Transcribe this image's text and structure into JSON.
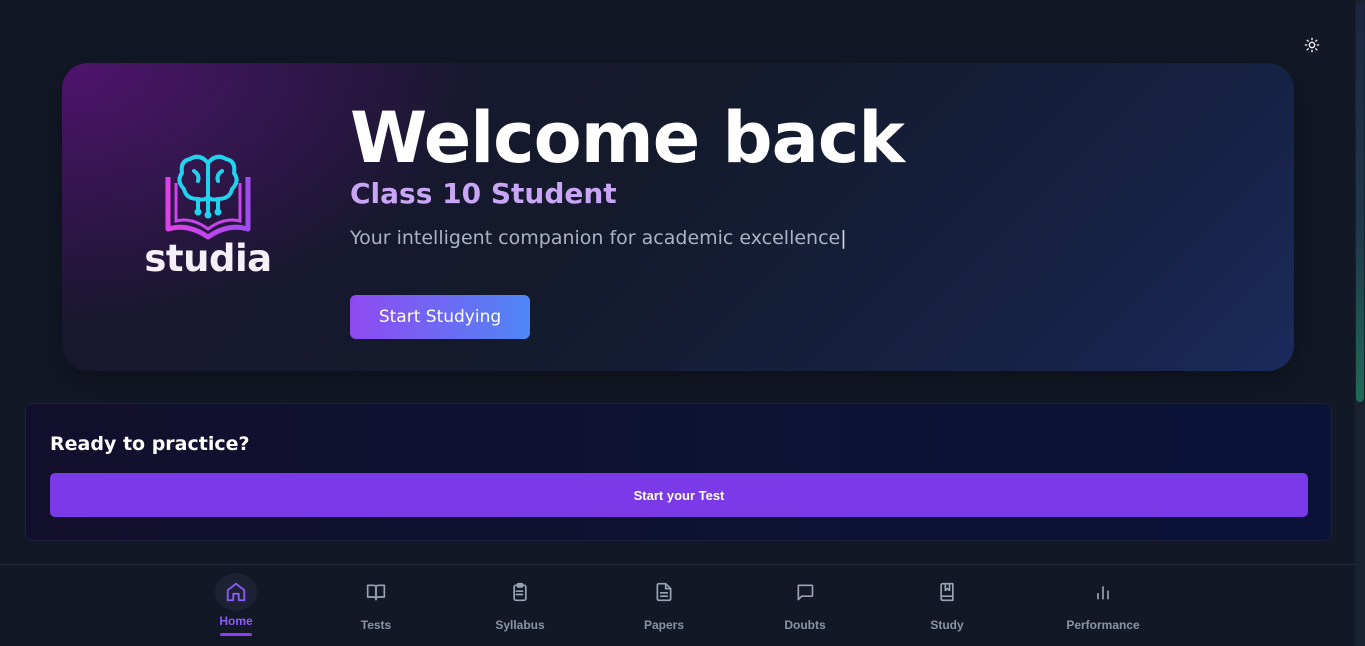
{
  "header": {
    "theme_toggle_icon": "sun-icon"
  },
  "hero": {
    "logo_text": "studia",
    "logo_icon": "brain-book-icon",
    "title": "Welcome back",
    "subtitle": "Class 10 Student",
    "description": "Your intelligent companion for academic excellence",
    "cursor": "|",
    "cta_label": "Start Studying"
  },
  "practice": {
    "title": "Ready to practice?",
    "button_label": "Start your Test"
  },
  "nav": {
    "items": [
      {
        "label": "Home",
        "icon": "home-icon",
        "active": true
      },
      {
        "label": "Tests",
        "icon": "book-open-icon",
        "active": false
      },
      {
        "label": "Syllabus",
        "icon": "clipboard-list-icon",
        "active": false
      },
      {
        "label": "Papers",
        "icon": "file-text-icon",
        "active": false
      },
      {
        "label": "Doubts",
        "icon": "message-square-icon",
        "active": false
      },
      {
        "label": "Study",
        "icon": "book-bookmark-icon",
        "active": false
      },
      {
        "label": "Performance",
        "icon": "bar-chart-icon",
        "active": false
      }
    ]
  },
  "colors": {
    "background": "#121826",
    "accent": "#7a3ae8",
    "subtitle": "#c9a6f5",
    "cta_gradient_start": "#8f4af2",
    "cta_gradient_end": "#4f86f5"
  }
}
